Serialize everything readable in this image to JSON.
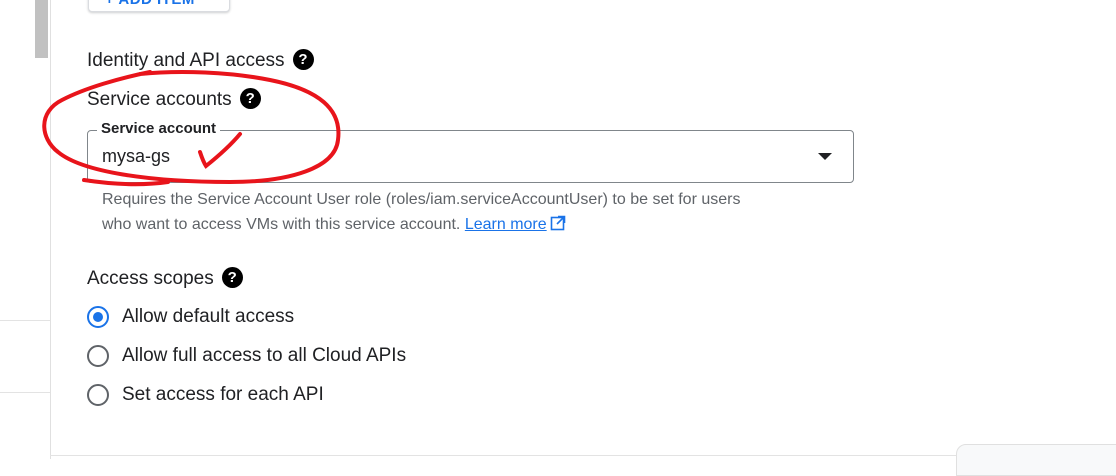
{
  "toolbar": {
    "add_item_label": "+ ADD ITEM"
  },
  "identity": {
    "heading": "Identity and API access",
    "help_glyph": "?"
  },
  "service_accounts": {
    "heading": "Service accounts",
    "help_glyph": "?",
    "field_label": "Service account",
    "selected_value": "mysa-gs",
    "hint_line1": "Requires the Service Account User role (roles/iam.serviceAccountUser) to be set for users",
    "hint_line2": "who want to access VMs with this service account.",
    "learn_more": "Learn more"
  },
  "access_scopes": {
    "heading": "Access scopes",
    "help_glyph": "?",
    "options": [
      {
        "label": "Allow default access",
        "checked": true
      },
      {
        "label": "Allow full access to all Cloud APIs",
        "checked": false
      },
      {
        "label": "Set access for each API",
        "checked": false
      }
    ]
  },
  "colors": {
    "accent": "#1a73e8",
    "annotation": "#e8141b",
    "text": "#202124",
    "hint": "#5f6368"
  }
}
